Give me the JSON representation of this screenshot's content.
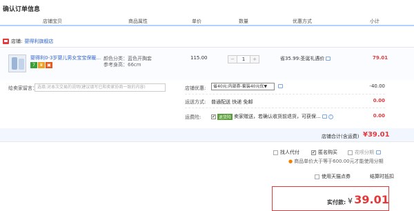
{
  "page": {
    "title": "确认订单信息"
  },
  "columns": [
    "店铺宝贝",
    "商品属性",
    "单价",
    "数量",
    "优惠方式",
    "小计"
  ],
  "shop": {
    "label": "店铺:",
    "name": "婴得利旗舰店"
  },
  "item": {
    "title": "婴得利0-3岁婴儿男女宝宝保暖...",
    "attr_color": "颜色分类：蓝色开胸套",
    "attr_height": "参考身高：66cm",
    "price": "115.00",
    "quantity": "1",
    "qty_minus": "−",
    "qty_plus": "+",
    "promo": "省35.99:圣诞礼遇价",
    "subtotal": "79.01",
    "badges": [
      "7",
      "♛",
      "▣"
    ],
    "badge_colors": [
      "#3a9f3a",
      "#f0a020",
      "#e05a20"
    ]
  },
  "message": {
    "label": "给卖家留言：",
    "placeholder": "选填:对本次交易的说明(建议填写已和卖家协商一致的内容)"
  },
  "shop_discount": {
    "label": "店铺优惠:",
    "selected": "省40元:内部券-套装40元优▼",
    "amount": "-40.00"
  },
  "shipping": {
    "label": "运送方式:",
    "method": "普通配送 快递 免邮",
    "amount": "0.00"
  },
  "insurance": {
    "label": "运费险:",
    "tag": "退货险",
    "text": "卖家赠送，若确认收货前退货，可获保...",
    "amount": "0.00"
  },
  "shop_total": {
    "label": "店铺合计(含运费)",
    "currency": "¥",
    "value": "39.01"
  },
  "options": {
    "pay_for_me": "找人代付",
    "anonymous": "匿名购买",
    "huabei": "花呗分期",
    "huabei_note": "商品单价大于等于600.00元才能使用分期",
    "tmall_points": "使用天猫点券",
    "check_discount": "结算时抵扣"
  },
  "payment": {
    "label": "实付款:",
    "currency": "¥",
    "value": "39.01"
  },
  "colors": {
    "accent_red": "#e4393c",
    "link_blue": "#3366cc",
    "header_line": "#b2d1ff"
  }
}
